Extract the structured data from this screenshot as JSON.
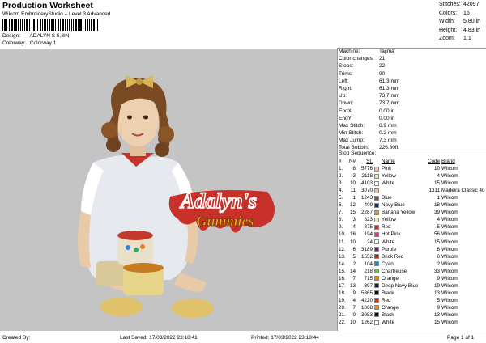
{
  "header": {
    "title": "Production Worksheet",
    "subtitle": "Wilcom EmbroideryStudio – Level 3 Advanced",
    "design_label": "Design:",
    "design_value": "ADALYN S 5,8IN",
    "colorway_label": "Colorway:",
    "colorway_value": "Colorway 1"
  },
  "stats": [
    {
      "k": "Stitches:",
      "v": "42097"
    },
    {
      "k": "Colors:",
      "v": "16"
    },
    {
      "k": "Width:",
      "v": "5.80 in"
    },
    {
      "k": "Height:",
      "v": "4.83 in"
    },
    {
      "k": "Zoom:",
      "v": "1:1"
    }
  ],
  "machine": [
    {
      "k": "Machine:",
      "v": "Tajima"
    },
    {
      "k": "Color changes:",
      "v": "21"
    },
    {
      "k": "Stops:",
      "v": "22"
    },
    {
      "k": "Trims:",
      "v": "90"
    },
    {
      "k": "Left:",
      "v": "61.3 mm"
    },
    {
      "k": "Right:",
      "v": "61.3 mm"
    },
    {
      "k": "Up:",
      "v": "73.7 mm"
    },
    {
      "k": "Down:",
      "v": "73.7 mm"
    },
    {
      "k": "EndX:",
      "v": "0.00 in"
    },
    {
      "k": "EndY:",
      "v": "0.00 in"
    },
    {
      "k": "Max Stitch:",
      "v": "8.9 mm"
    },
    {
      "k": "Min Stitch:",
      "v": "0.2 mm"
    },
    {
      "k": "Max Jump:",
      "v": "7.3 mm"
    },
    {
      "k": "Total Bobbin:",
      "v": "226.80ft"
    }
  ],
  "sequence": {
    "title": "Stop Sequence:",
    "headers": {
      "num": "#",
      "id": "N#",
      "st": "St.",
      "name": "Name",
      "code": "Code",
      "brand": "Brand"
    },
    "rows": [
      {
        "num": "1.",
        "id": "8",
        "st": "5776",
        "color": "#f3b7b7",
        "name": "Pink",
        "code": "10",
        "brand": "Wilcom"
      },
      {
        "num": "2.",
        "id": "3",
        "st": "2118",
        "color": "#ede8b0",
        "name": "Yellow",
        "code": "4",
        "brand": "Wilcom"
      },
      {
        "num": "3.",
        "id": "10",
        "st": "4103",
        "color": "#ffffff",
        "name": "White",
        "code": "15",
        "brand": "Wilcom"
      },
      {
        "num": "4.",
        "id": "11",
        "st": "3070",
        "color": "#e6c9a6",
        "name": "",
        "code": "1311",
        "brand": "Madeira Classic 40"
      },
      {
        "num": "5.",
        "id": "1",
        "st": "1243",
        "color": "#6a5a4a",
        "name": "Blue",
        "code": "1",
        "brand": "Wilcom"
      },
      {
        "num": "6.",
        "id": "12",
        "st": "409",
        "color": "#1a2a5a",
        "name": "Navy Blue",
        "code": "18",
        "brand": "Wilcom"
      },
      {
        "num": "7.",
        "id": "15",
        "st": "2287",
        "color": "#c9a548",
        "name": "Banana Yellow",
        "code": "39",
        "brand": "Wilcom"
      },
      {
        "num": "8.",
        "id": "3",
        "st": "623",
        "color": "#ede8b0",
        "name": "Yellow",
        "code": "4",
        "brand": "Wilcom"
      },
      {
        "num": "9.",
        "id": "4",
        "st": "875",
        "color": "#c73030",
        "name": "Red",
        "code": "5",
        "brand": "Wilcom"
      },
      {
        "num": "10.",
        "id": "16",
        "st": "194",
        "color": "#e23b8a",
        "name": "Hot Pink",
        "code": "56",
        "brand": "Wilcom"
      },
      {
        "num": "11.",
        "id": "10",
        "st": "24",
        "color": "#ffffff",
        "name": "White",
        "code": "15",
        "brand": "Wilcom"
      },
      {
        "num": "12.",
        "id": "6",
        "st": "3189",
        "color": "#6a2a7a",
        "name": "Purple",
        "code": "8",
        "brand": "Wilcom"
      },
      {
        "num": "13.",
        "id": "5",
        "st": "1552",
        "color": "#a0301a",
        "name": "Brick Red",
        "code": "6",
        "brand": "Wilcom"
      },
      {
        "num": "14.",
        "id": "2",
        "st": "104",
        "color": "#1e8fd0",
        "name": "Cyan",
        "code": "2",
        "brand": "Wilcom"
      },
      {
        "num": "15.",
        "id": "14",
        "st": "218",
        "color": "#6abf2a",
        "name": "Chartreuse",
        "code": "33",
        "brand": "Wilcom"
      },
      {
        "num": "16.",
        "id": "7",
        "st": "715",
        "color": "#e8891a",
        "name": "Orange",
        "code": "9",
        "brand": "Wilcom"
      },
      {
        "num": "17.",
        "id": "13",
        "st": "397",
        "color": "#1a2048",
        "name": "Deep Navy Blue",
        "code": "19",
        "brand": "Wilcom"
      },
      {
        "num": "18.",
        "id": "9",
        "st": "5365",
        "color": "#111111",
        "name": "Black",
        "code": "13",
        "brand": "Wilcom"
      },
      {
        "num": "19.",
        "id": "4",
        "st": "4220",
        "color": "#c73030",
        "name": "Red",
        "code": "5",
        "brand": "Wilcom"
      },
      {
        "num": "20.",
        "id": "7",
        "st": "1068",
        "color": "#e8891a",
        "name": "Orange",
        "code": "9",
        "brand": "Wilcom"
      },
      {
        "num": "21.",
        "id": "9",
        "st": "3083",
        "color": "#111111",
        "name": "Black",
        "code": "13",
        "brand": "Wilcom"
      },
      {
        "num": "22.",
        "id": "10",
        "st": "1262",
        "color": "#ffffff",
        "name": "White",
        "code": "15",
        "brand": "Wilcom"
      }
    ]
  },
  "artwork": {
    "logo_text_1": "Adalyn's",
    "logo_text_2": "Gummies"
  },
  "footer": {
    "created_by": "Created By:",
    "last_saved": "Last Saved: 17/03/2022 23:18:41",
    "printed": "Printed: 17/03/2022 23:18:44",
    "page": "Page 1 of 1"
  }
}
